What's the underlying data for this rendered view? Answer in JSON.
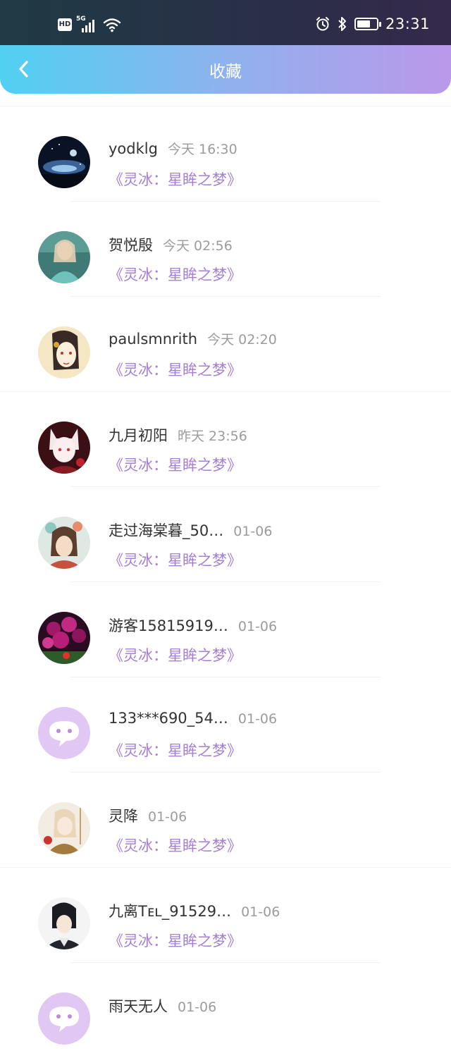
{
  "status_bar": {
    "hd_label": "HD",
    "network_label": "5G",
    "time": "23:31",
    "battery_level": 0.7,
    "icons": [
      "hd-icon",
      "signal-icon",
      "wifi-icon",
      "alarm-icon",
      "bluetooth-icon",
      "battery-icon"
    ]
  },
  "header": {
    "title": "收藏",
    "back_icon": "chevron-left-icon",
    "gradient": [
      "#50d0f2",
      "#bb98ea"
    ]
  },
  "colors": {
    "work_title": "#a57fd4",
    "name": "#333333",
    "time": "#9c9c9c"
  },
  "favorites": [
    {
      "name": "yodklg",
      "time": "今天 16:30",
      "work": "《灵冰：星眸之梦》",
      "avatar": "avatar-night-sky"
    },
    {
      "name": "贺悦殷",
      "time": "今天 02:56",
      "work": "《灵冰：星眸之梦》",
      "avatar": "avatar-photo-teal"
    },
    {
      "name": "paulsmnrith",
      "time": "今天 02:20",
      "work": "《灵冰：星眸之梦》",
      "avatar": "avatar-illustration-cream"
    },
    {
      "name": "九月初阳",
      "time": "昨天 23:56",
      "work": "《灵冰：星眸之梦》",
      "avatar": "avatar-anime-red"
    },
    {
      "name": "走过海棠暮_50…",
      "time": "01-06",
      "work": "《灵冰：星眸之梦》",
      "avatar": "avatar-illustration-floral"
    },
    {
      "name": "游客15815919…",
      "time": "01-06",
      "work": "《灵冰：星眸之梦》",
      "avatar": "avatar-flowers-magenta"
    },
    {
      "name": "133***690_54…",
      "time": "01-06",
      "work": "《灵冰：星眸之梦》",
      "avatar": "avatar-default-chat"
    },
    {
      "name": "灵降",
      "time": "01-06",
      "work": "《灵冰：星眸之梦》",
      "avatar": "avatar-illustration-tan"
    },
    {
      "name": "九离Tᴇʟ_91529…",
      "time": "01-06",
      "work": "《灵冰：星眸之梦》",
      "avatar": "avatar-anime-dark"
    },
    {
      "name": "雨天无人",
      "time": "01-06",
      "work": "",
      "avatar": "avatar-default-chat"
    }
  ]
}
